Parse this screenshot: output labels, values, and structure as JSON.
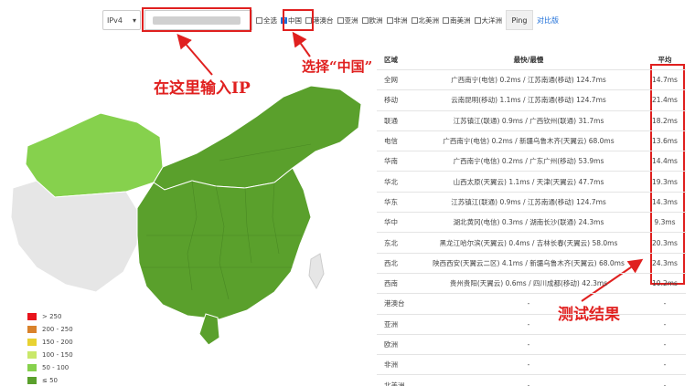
{
  "toolbar": {
    "ip_version": "IPv4",
    "ip_placeholder": "",
    "checkboxes": [
      {
        "label": "全选",
        "checked": false
      },
      {
        "label": "中国",
        "checked": true
      },
      {
        "label": "港澳台",
        "checked": false
      },
      {
        "label": "亚洲",
        "checked": false
      },
      {
        "label": "欧洲",
        "checked": false
      },
      {
        "label": "非洲",
        "checked": false
      },
      {
        "label": "北美洲",
        "checked": false
      },
      {
        "label": "南美洲",
        "checked": false
      },
      {
        "label": "大洋洲",
        "checked": false
      }
    ],
    "ping_label": "Ping",
    "compare_label": "对比版"
  },
  "annotations": {
    "input_hint": "在这里输入IP",
    "china_hint": "选择“中国”",
    "result_hint": "测试结果"
  },
  "table": {
    "headers": [
      "区域",
      "最快/最慢",
      "平均"
    ],
    "rows": [
      {
        "region": "全网",
        "range": "广西南宁(电信) 0.2ms / 江苏南通(移动) 124.7ms",
        "avg": "14.7ms"
      },
      {
        "region": "移动",
        "range": "云南昆明(移动) 1.1ms / 江苏南通(移动) 124.7ms",
        "avg": "21.4ms"
      },
      {
        "region": "联通",
        "range": "江苏镇江(联通) 0.9ms / 广西钦州(联通) 31.7ms",
        "avg": "18.2ms"
      },
      {
        "region": "电信",
        "range": "广西南宁(电信) 0.2ms / 新疆乌鲁木齐(天翼云) 68.0ms",
        "avg": "13.6ms"
      },
      {
        "region": "华南",
        "range": "广西南宁(电信) 0.2ms / 广东广州(移动) 53.9ms",
        "avg": "14.4ms"
      },
      {
        "region": "华北",
        "range": "山西太原(天翼云) 1.1ms / 天津(天翼云) 47.7ms",
        "avg": "19.3ms"
      },
      {
        "region": "华东",
        "range": "江苏镇江(联通) 0.9ms / 江苏南通(移动) 124.7ms",
        "avg": "14.3ms"
      },
      {
        "region": "华中",
        "range": "湖北黄冈(电信) 0.3ms / 湖南长沙(联通) 24.3ms",
        "avg": "9.3ms"
      },
      {
        "region": "东北",
        "range": "黑龙江哈尔滨(天翼云) 0.4ms / 吉林长春(天翼云) 58.0ms",
        "avg": "20.3ms"
      },
      {
        "region": "西北",
        "range": "陕西西安(天翼云二区) 4.1ms / 新疆乌鲁木齐(天翼云) 68.0ms",
        "avg": "24.3ms"
      },
      {
        "region": "西南",
        "range": "贵州贵阳(天翼云) 0.6ms / 四川成都(移动) 42.3ms",
        "avg": "10.2ms"
      },
      {
        "region": "港澳台",
        "range": "-",
        "avg": "-"
      },
      {
        "region": "亚洲",
        "range": "-",
        "avg": "-"
      },
      {
        "region": "欧洲",
        "range": "-",
        "avg": "-"
      },
      {
        "region": "非洲",
        "range": "-",
        "avg": "-"
      },
      {
        "region": "北美洲",
        "range": "-",
        "avg": "-"
      }
    ]
  },
  "legend": [
    {
      "label": "> 250",
      "color": "#e8141c"
    },
    {
      "label": "200 - 250",
      "color": "#d9822b"
    },
    {
      "label": "150 - 200",
      "color": "#e8d232"
    },
    {
      "label": "100 - 150",
      "color": "#c9e86a"
    },
    {
      "label": "50 - 100",
      "color": "#86d14d"
    },
    {
      "label": "≤ 50",
      "color": "#5aa02c"
    }
  ],
  "colors": {
    "accent": "#1e6fd9",
    "annotation": "#e0201f",
    "map_fast": "#5aa02c",
    "map_mid": "#86d14d",
    "map_none": "#e6e6e6"
  }
}
